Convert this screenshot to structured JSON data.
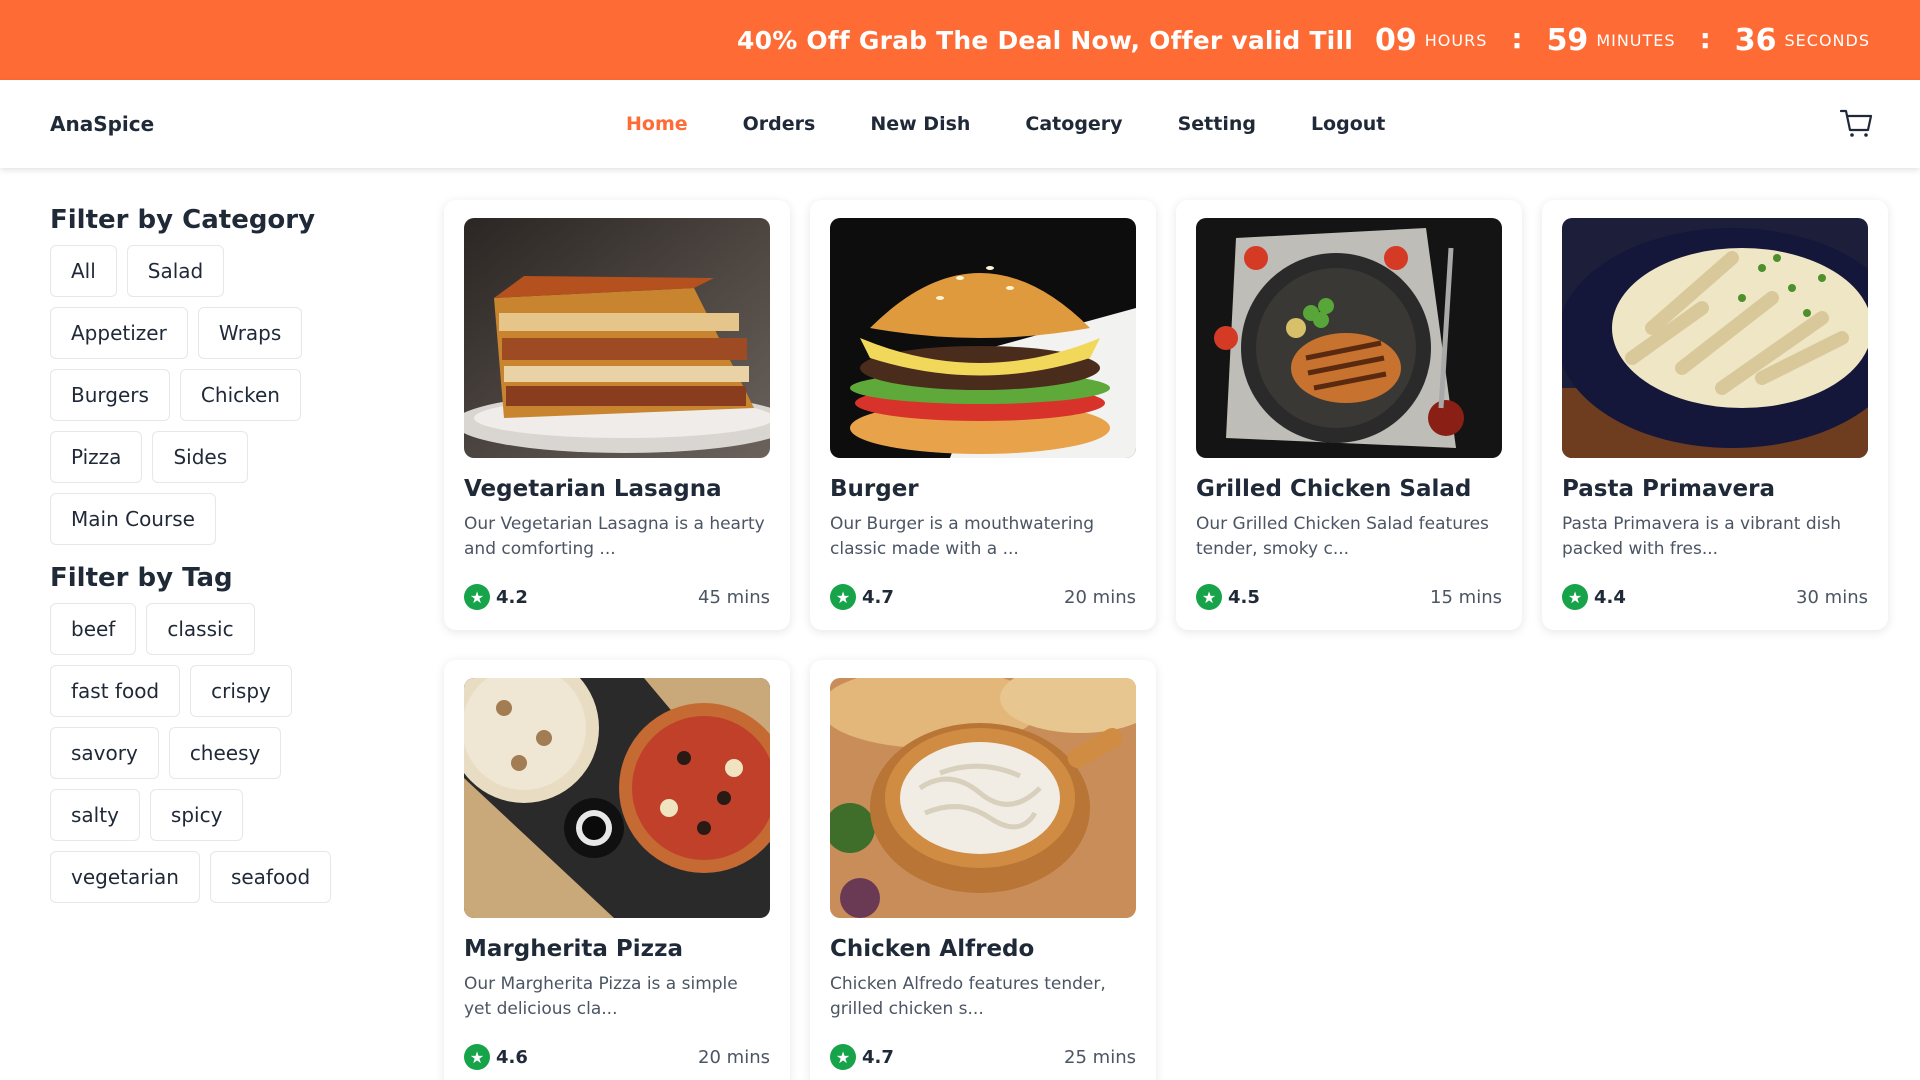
{
  "promo": {
    "text": "40% Off Grab The Deal Now, Offer valid Till",
    "hours": "09",
    "hours_label": "HOURS",
    "minutes": "59",
    "minutes_label": "MINUTES",
    "seconds": "36",
    "seconds_label": "SECONDS",
    "separator": ":"
  },
  "navbar": {
    "brand": "AnaSpice",
    "links": [
      "Home",
      "Orders",
      "New Dish",
      "Catogery",
      "Setting",
      "Logout"
    ],
    "active": "Home"
  },
  "sidebar": {
    "category_title": "Filter by Category",
    "categories": [
      "All",
      "Salad",
      "Appetizer",
      "Wraps",
      "Burgers",
      "Chicken",
      "Pizza",
      "Sides",
      "Main Course"
    ],
    "tag_title": "Filter by Tag",
    "tags": [
      "beef",
      "classic",
      "fast food",
      "crispy",
      "savory",
      "cheesy",
      "salty",
      "spicy",
      "vegetarian",
      "seafood"
    ]
  },
  "dishes": [
    {
      "name": "Vegetarian Lasagna",
      "desc": "Our Vegetarian Lasagna is a hearty and comforting ...",
      "rating": "4.2",
      "time": "45 mins"
    },
    {
      "name": "Burger",
      "desc": "Our Burger is a mouthwatering classic made with a ...",
      "rating": "4.7",
      "time": "20 mins"
    },
    {
      "name": "Grilled Chicken Salad",
      "desc": "Our Grilled Chicken Salad features tender, smoky c...",
      "rating": "4.5",
      "time": "15 mins"
    },
    {
      "name": "Pasta Primavera",
      "desc": "Pasta Primavera is a vibrant dish packed with fres...",
      "rating": "4.4",
      "time": "30 mins"
    },
    {
      "name": "Margherita Pizza",
      "desc": "Our Margherita Pizza is a simple yet delicious cla...",
      "rating": "4.6",
      "time": "20 mins"
    },
    {
      "name": "Chicken Alfredo",
      "desc": "Chicken Alfredo features tender, grilled chicken s...",
      "rating": "4.7",
      "time": "25 mins"
    }
  ],
  "colors": {
    "accent": "#ff6b35",
    "rating": "#16a34a"
  }
}
